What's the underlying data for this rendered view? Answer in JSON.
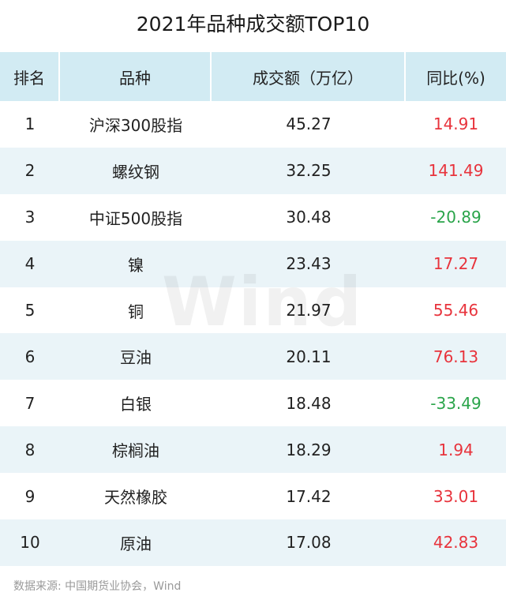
{
  "title": "2021年品种成交额TOP10",
  "header": {
    "rank": "排名",
    "name": "品种",
    "value": "成交额（万亿）",
    "change": "同比(%)"
  },
  "rows": [
    {
      "rank": "1",
      "name": "沪深300股指",
      "value": "45.27",
      "change": "14.91"
    },
    {
      "rank": "2",
      "name": "螺纹钢",
      "value": "32.25",
      "change": "141.49"
    },
    {
      "rank": "3",
      "name": "中证500股指",
      "value": "30.48",
      "change": "-20.89"
    },
    {
      "rank": "4",
      "name": "镍",
      "value": "23.43",
      "change": "17.27"
    },
    {
      "rank": "5",
      "name": "铜",
      "value": "21.97",
      "change": "55.46"
    },
    {
      "rank": "6",
      "name": "豆油",
      "value": "20.11",
      "change": "76.13"
    },
    {
      "rank": "7",
      "name": "白银",
      "value": "18.48",
      "change": "-33.49"
    },
    {
      "rank": "8",
      "name": "棕榈油",
      "value": "18.29",
      "change": "1.94"
    },
    {
      "rank": "9",
      "name": "天然橡胶",
      "value": "17.42",
      "change": "33.01"
    },
    {
      "rank": "10",
      "name": "原油",
      "value": "17.08",
      "change": "42.83"
    }
  ],
  "watermark": "Wind",
  "source": "数据来源: 中国期货业协会，Wind",
  "colors": {
    "header_bg": "#d2ebf3",
    "alt_row_bg": "#eaf4f8",
    "positive": "#e8333c",
    "negative": "#2aa44a"
  }
}
